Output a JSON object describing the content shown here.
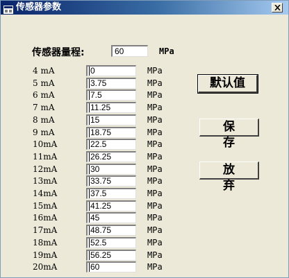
{
  "window": {
    "title": "传感器参数",
    "close_label": "X"
  },
  "range": {
    "label": "传感器量程:",
    "value": "60",
    "unit": "MPa"
  },
  "rows": [
    {
      "label": "4 mA",
      "value": "0",
      "unit": "MPa"
    },
    {
      "label": "5 mA",
      "value": "3.75",
      "unit": "MPa"
    },
    {
      "label": "6 mA",
      "value": "7.5",
      "unit": "MPa"
    },
    {
      "label": "7 mA",
      "value": "11.25",
      "unit": "MPa"
    },
    {
      "label": "8 mA",
      "value": "15",
      "unit": "MPa"
    },
    {
      "label": "9 mA",
      "value": "18.75",
      "unit": "MPa"
    },
    {
      "label": "10mA",
      "value": "22.5",
      "unit": "MPa"
    },
    {
      "label": "11mA",
      "value": "26.25",
      "unit": "MPa"
    },
    {
      "label": "12mA",
      "value": "30",
      "unit": "MPa"
    },
    {
      "label": "13mA",
      "value": "33.75",
      "unit": "MPa"
    },
    {
      "label": "14mA",
      "value": "37.5",
      "unit": "MPa"
    },
    {
      "label": "15mA",
      "value": "41.25",
      "unit": "MPa"
    },
    {
      "label": "16mA",
      "value": "45",
      "unit": "MPa"
    },
    {
      "label": "17mA",
      "value": "48.75",
      "unit": "MPa"
    },
    {
      "label": "18mA",
      "value": "52.5",
      "unit": "MPa"
    },
    {
      "label": "19mA",
      "value": "56.25",
      "unit": "MPa"
    },
    {
      "label": "20mA",
      "value": "60",
      "unit": "MPa"
    }
  ],
  "buttons": {
    "default_label": "默认值",
    "save_label": "保 存",
    "cancel_label": "放 弃"
  },
  "icons": {
    "title": "app-icon",
    "close": "close-icon"
  }
}
